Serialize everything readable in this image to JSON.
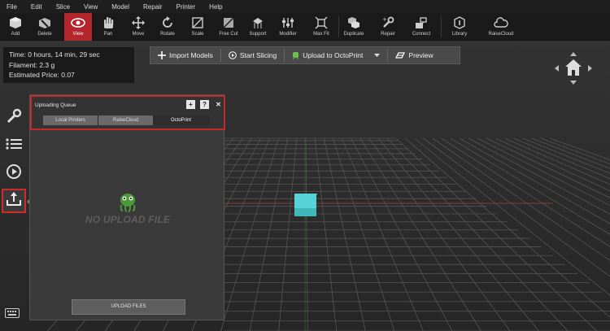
{
  "menu": [
    "File",
    "Edit",
    "Slice",
    "View",
    "Model",
    "Repair",
    "Printer",
    "Help"
  ],
  "toolbar": {
    "items": [
      {
        "label": "Add",
        "icon": "add-model-icon"
      },
      {
        "label": "Delete",
        "icon": "delete-icon"
      },
      {
        "label": "View",
        "icon": "eye-icon"
      },
      {
        "label": "Pan",
        "icon": "hand-icon"
      },
      {
        "label": "Move",
        "icon": "move-arrows-icon"
      },
      {
        "label": "Rotate",
        "icon": "rotate-icon"
      },
      {
        "label": "Scale",
        "icon": "scale-icon"
      },
      {
        "label": "Free Cut",
        "icon": "cut-icon"
      },
      {
        "label": "Support",
        "icon": "support-icon"
      },
      {
        "label": "Modifier",
        "icon": "modifier-icon"
      },
      {
        "label": "Max Fit",
        "icon": "max-fit-icon"
      },
      {
        "label": "Duplicate",
        "icon": "duplicate-icon"
      },
      {
        "label": "Repair",
        "icon": "wrench-icon"
      },
      {
        "label": "Connect",
        "icon": "connect-icon"
      },
      {
        "label": "Library",
        "icon": "library-icon"
      },
      {
        "label": "RaiseCloud",
        "icon": "cloud-icon"
      }
    ],
    "active": "View"
  },
  "info": {
    "time": "Time: 0 hours, 14 min, 29 sec",
    "filament": "Filament: 2.3 g",
    "price": "Estimated Price: 0.07"
  },
  "actions": {
    "import": "Import Models",
    "slicing": "Start Slicing",
    "upload": "Upload to OctoPrint",
    "preview": "Preview"
  },
  "panel": {
    "title": "Uploading Queue",
    "tabs": [
      "Local Printers",
      "RaiseCloud",
      "OctoPrint"
    ],
    "selected_tab": "OctoPrint",
    "empty_text": "NO UPLOAD FILE",
    "upload_button": "UPLOAD FILES"
  },
  "colors": {
    "accent": "#b3262b",
    "cube": "#4fd0d4",
    "grid": "#4a4a4a"
  }
}
